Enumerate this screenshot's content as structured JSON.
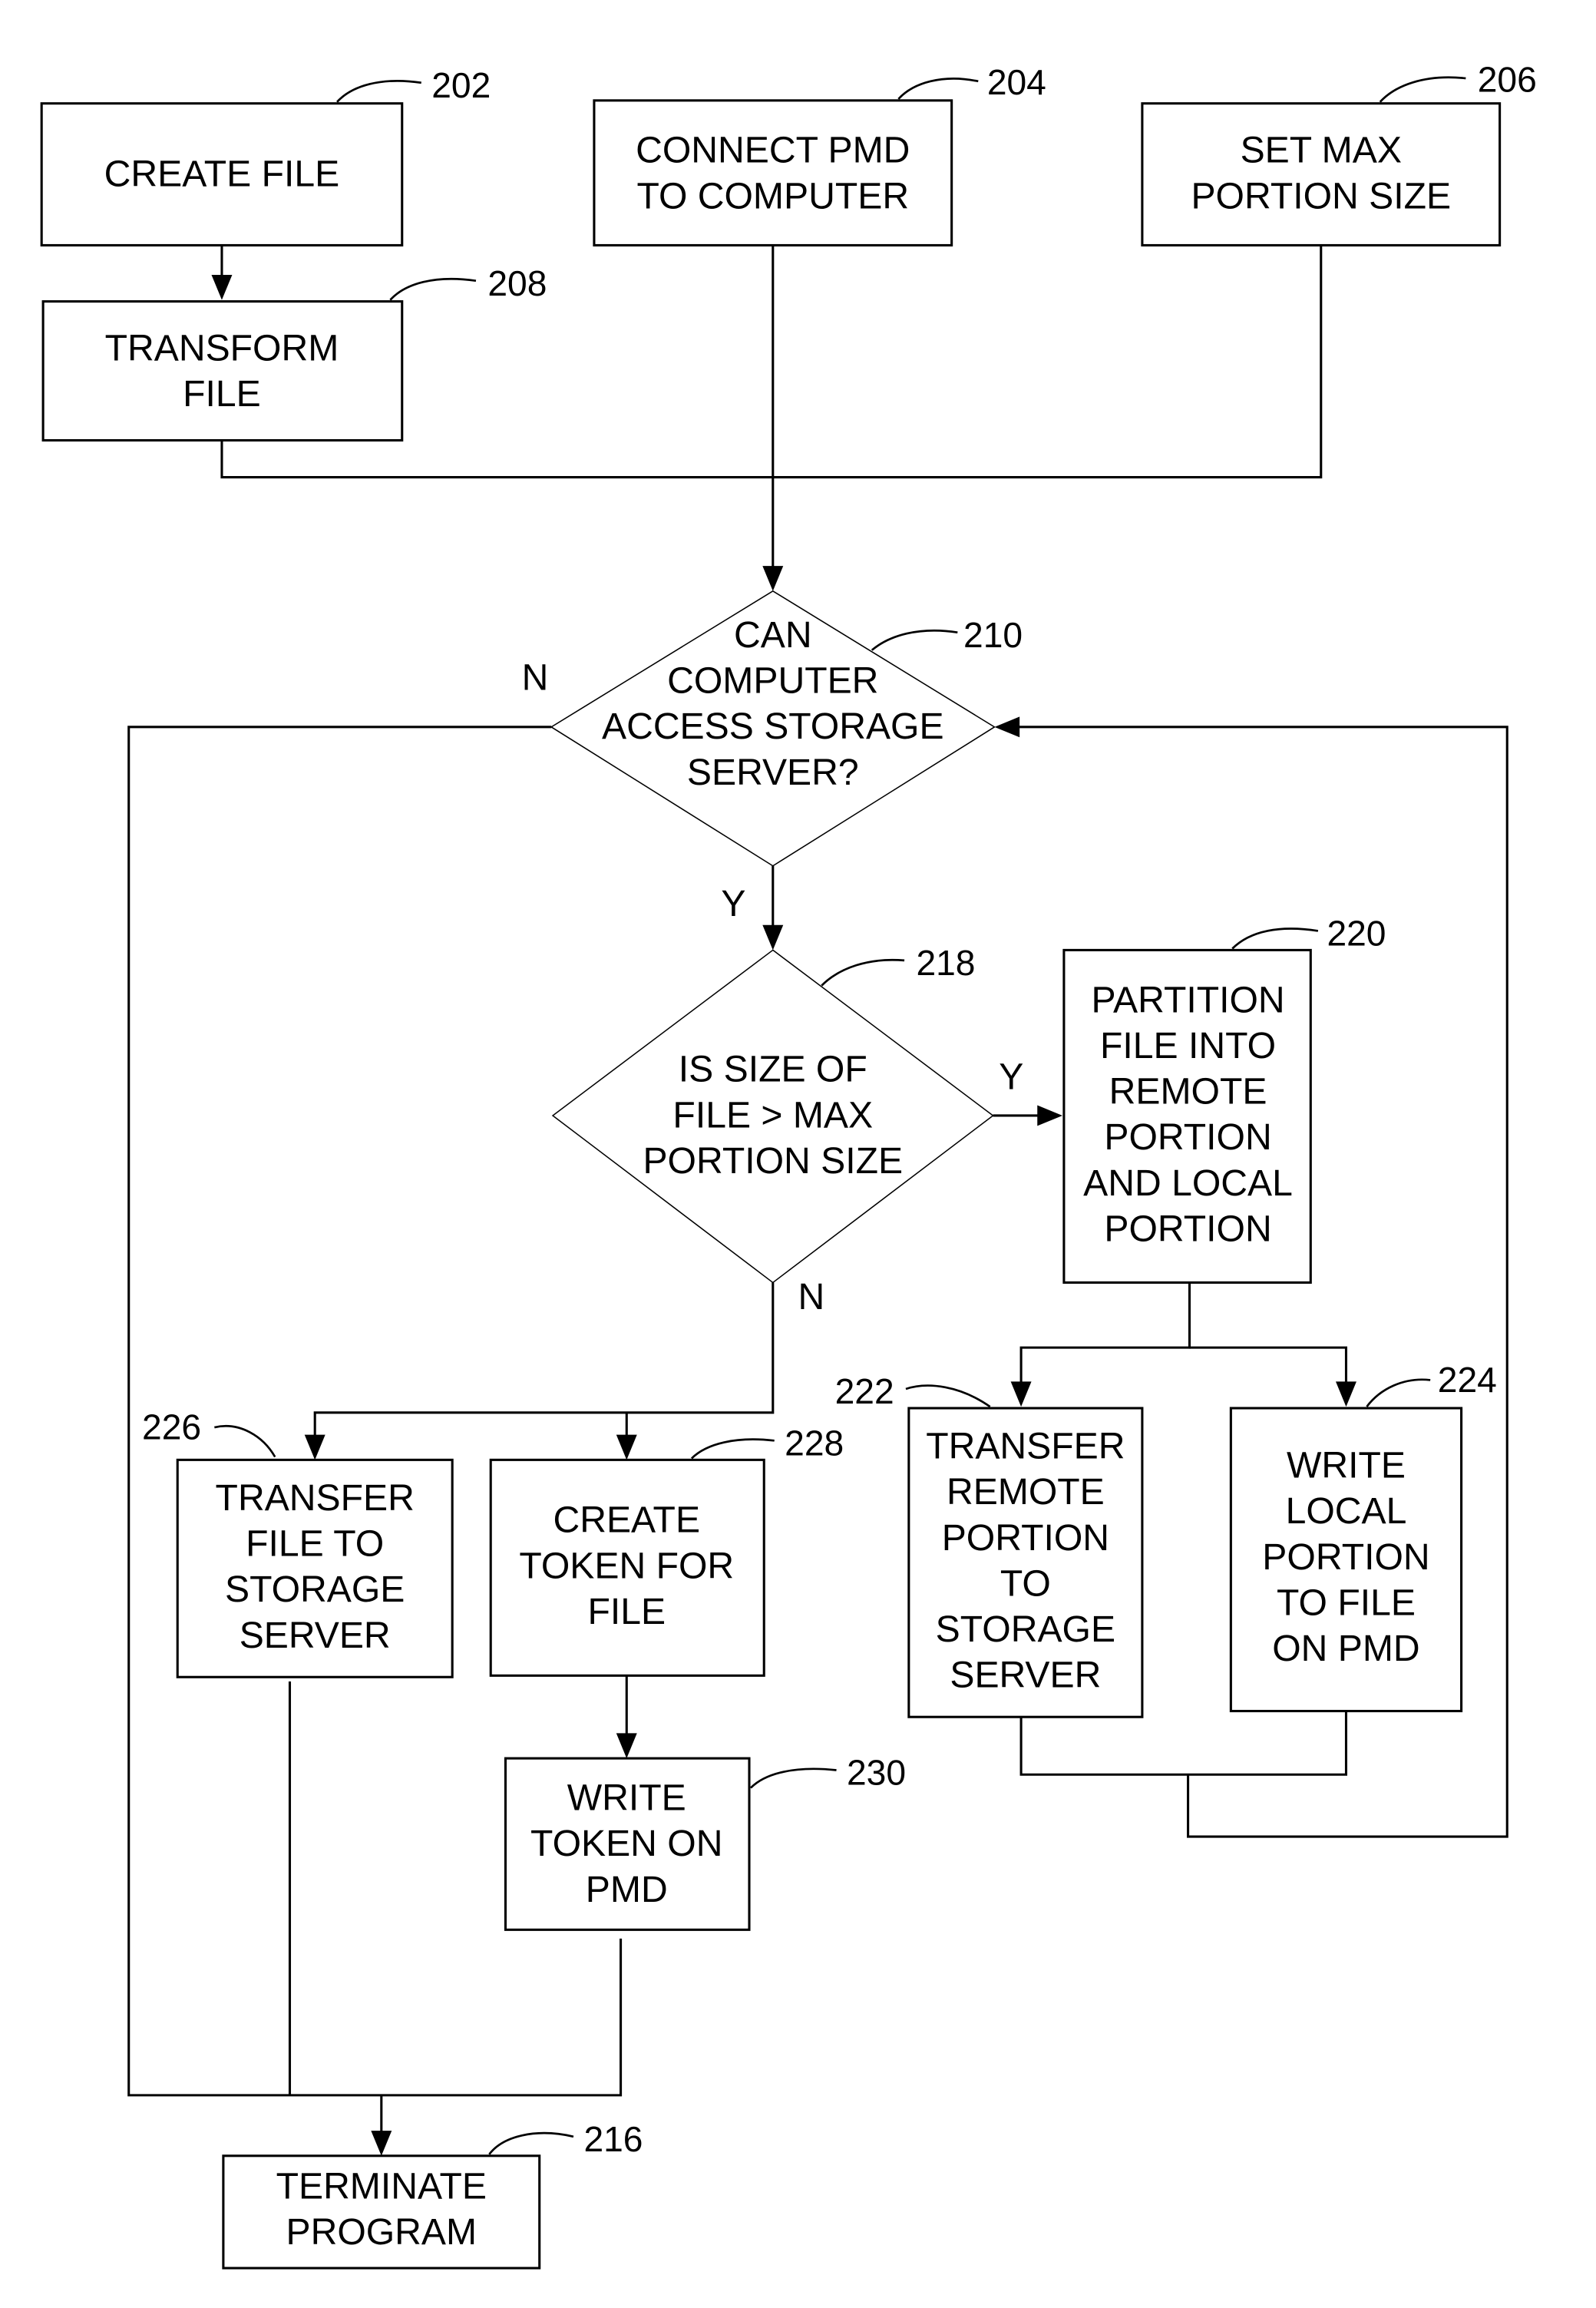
{
  "figure": {
    "nodes": {
      "n202": {
        "ref": "202",
        "lines": [
          "CREATE FILE"
        ]
      },
      "n204": {
        "ref": "204",
        "lines": [
          "CONNECT PMD",
          "TO COMPUTER"
        ]
      },
      "n206": {
        "ref": "206",
        "lines": [
          "SET MAX",
          "PORTION SIZE"
        ]
      },
      "n208": {
        "ref": "208",
        "lines": [
          "TRANSFORM",
          "FILE"
        ]
      },
      "n210": {
        "ref": "210",
        "lines": [
          "CAN",
          "COMPUTER",
          "ACCESS STORAGE",
          "SERVER?"
        ]
      },
      "n218": {
        "ref": "218",
        "lines": [
          "IS SIZE OF",
          "FILE > MAX",
          "PORTION SIZE"
        ]
      },
      "n220": {
        "ref": "220",
        "lines": [
          "PARTITION",
          "FILE INTO",
          "REMOTE",
          "PORTION",
          "AND LOCAL",
          "PORTION"
        ]
      },
      "n222": {
        "ref": "222",
        "lines": [
          "TRANSFER",
          "REMOTE",
          "PORTION",
          "TO",
          "STORAGE",
          "SERVER"
        ]
      },
      "n224": {
        "ref": "224",
        "lines": [
          "WRITE",
          "LOCAL",
          "PORTION",
          "TO FILE",
          "ON PMD"
        ]
      },
      "n226": {
        "ref": "226",
        "lines": [
          "TRANSFER",
          "FILE TO",
          "STORAGE",
          "SERVER"
        ]
      },
      "n228": {
        "ref": "228",
        "lines": [
          "CREATE",
          "TOKEN FOR",
          "FILE"
        ]
      },
      "n230": {
        "ref": "230",
        "lines": [
          "WRITE",
          "TOKEN ON",
          "PMD"
        ]
      },
      "n216": {
        "ref": "216",
        "lines": [
          "TERMINATE",
          "PROGRAM"
        ]
      }
    },
    "branch_labels": {
      "d210_no": "N",
      "d210_yes": "Y",
      "d218_yes": "Y",
      "d218_no": "N"
    }
  }
}
